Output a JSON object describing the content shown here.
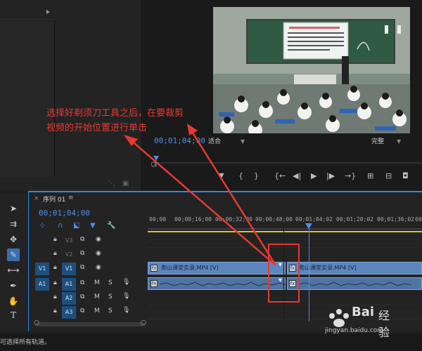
{
  "monitor": {
    "timecode": "00;01;04;00",
    "fit_select": "适合",
    "quality_select": "完整"
  },
  "timeline": {
    "tab_label": "序列 01",
    "tab_menu": "≡",
    "timecode": "00;01;04;00",
    "ruler": [
      "00;00",
      "00;00;16;00",
      "00;00;32;00",
      "00;00;48;00",
      "00;01;04;02",
      "00;01;20;02",
      "00;01;36;02",
      "00"
    ],
    "tracks": [
      {
        "src": "",
        "name": "V3"
      },
      {
        "src": "",
        "name": "V2"
      },
      {
        "src": "V1",
        "name": "V1"
      },
      {
        "src": "A1",
        "name": "A1"
      },
      {
        "src": "",
        "name": "A2"
      },
      {
        "src": "",
        "name": "A3"
      }
    ],
    "mute_label": "M",
    "solo_label": "S",
    "clip_label_left": "爬山课堂实录.MP4 [V]",
    "clip_label_right": "爬山课堂实录.MP4 [V]",
    "fx_label": "fx"
  },
  "status_bar": {
    "text": "可选择所有轨道。"
  },
  "annotation": {
    "line1": "选择好剃须刀工具之后，在要裁剪",
    "line2": "视频的开始位置进行单击"
  },
  "watermark": {
    "brand_left": "Bai",
    "brand_right": "经验",
    "url": "jingyan.baidu.com"
  },
  "colors": {
    "accent_blue": "#2d8ceb",
    "clip_blue": "#5d86bd",
    "annotation_red": "#e53a31"
  }
}
